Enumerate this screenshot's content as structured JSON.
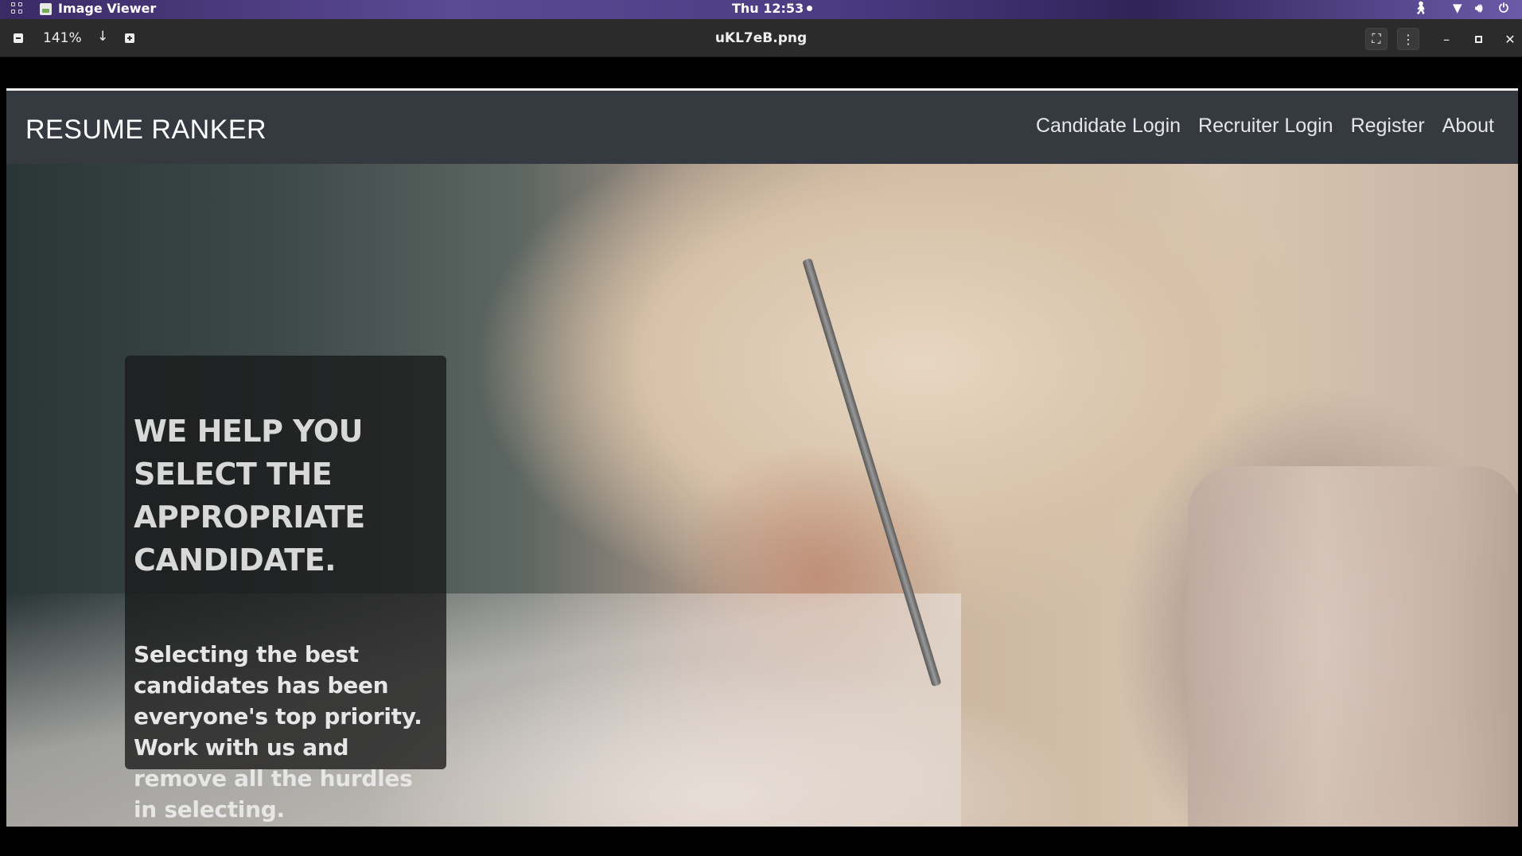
{
  "system_bar": {
    "app_name": "Image Viewer",
    "clock": "Thu 12:53",
    "tray_icons": [
      "accessibility-icon",
      "wifi-icon",
      "volume-icon",
      "power-icon"
    ]
  },
  "viewer": {
    "zoom": "141%",
    "filename": "uKL7eB.png",
    "buttons": [
      "zoom-out-icon",
      "zoom-dropdown-icon",
      "zoom-in-icon",
      "fullscreen-icon",
      "menu-icon",
      "minimize-icon",
      "maximize-icon",
      "close-icon"
    ]
  },
  "site": {
    "brand": "RESUME RANKER",
    "nav": [
      "Candidate Login",
      "Recruiter Login",
      "Register",
      "About"
    ],
    "hero_title": "WE HELP YOU SELECT THE APPROPRIATE CANDIDATE.",
    "hero_text": "Selecting the best candidates has been everyone's top priority. Work with us and remove all the hurdles in selecting.",
    "nav_bg_color": "#343a40"
  }
}
